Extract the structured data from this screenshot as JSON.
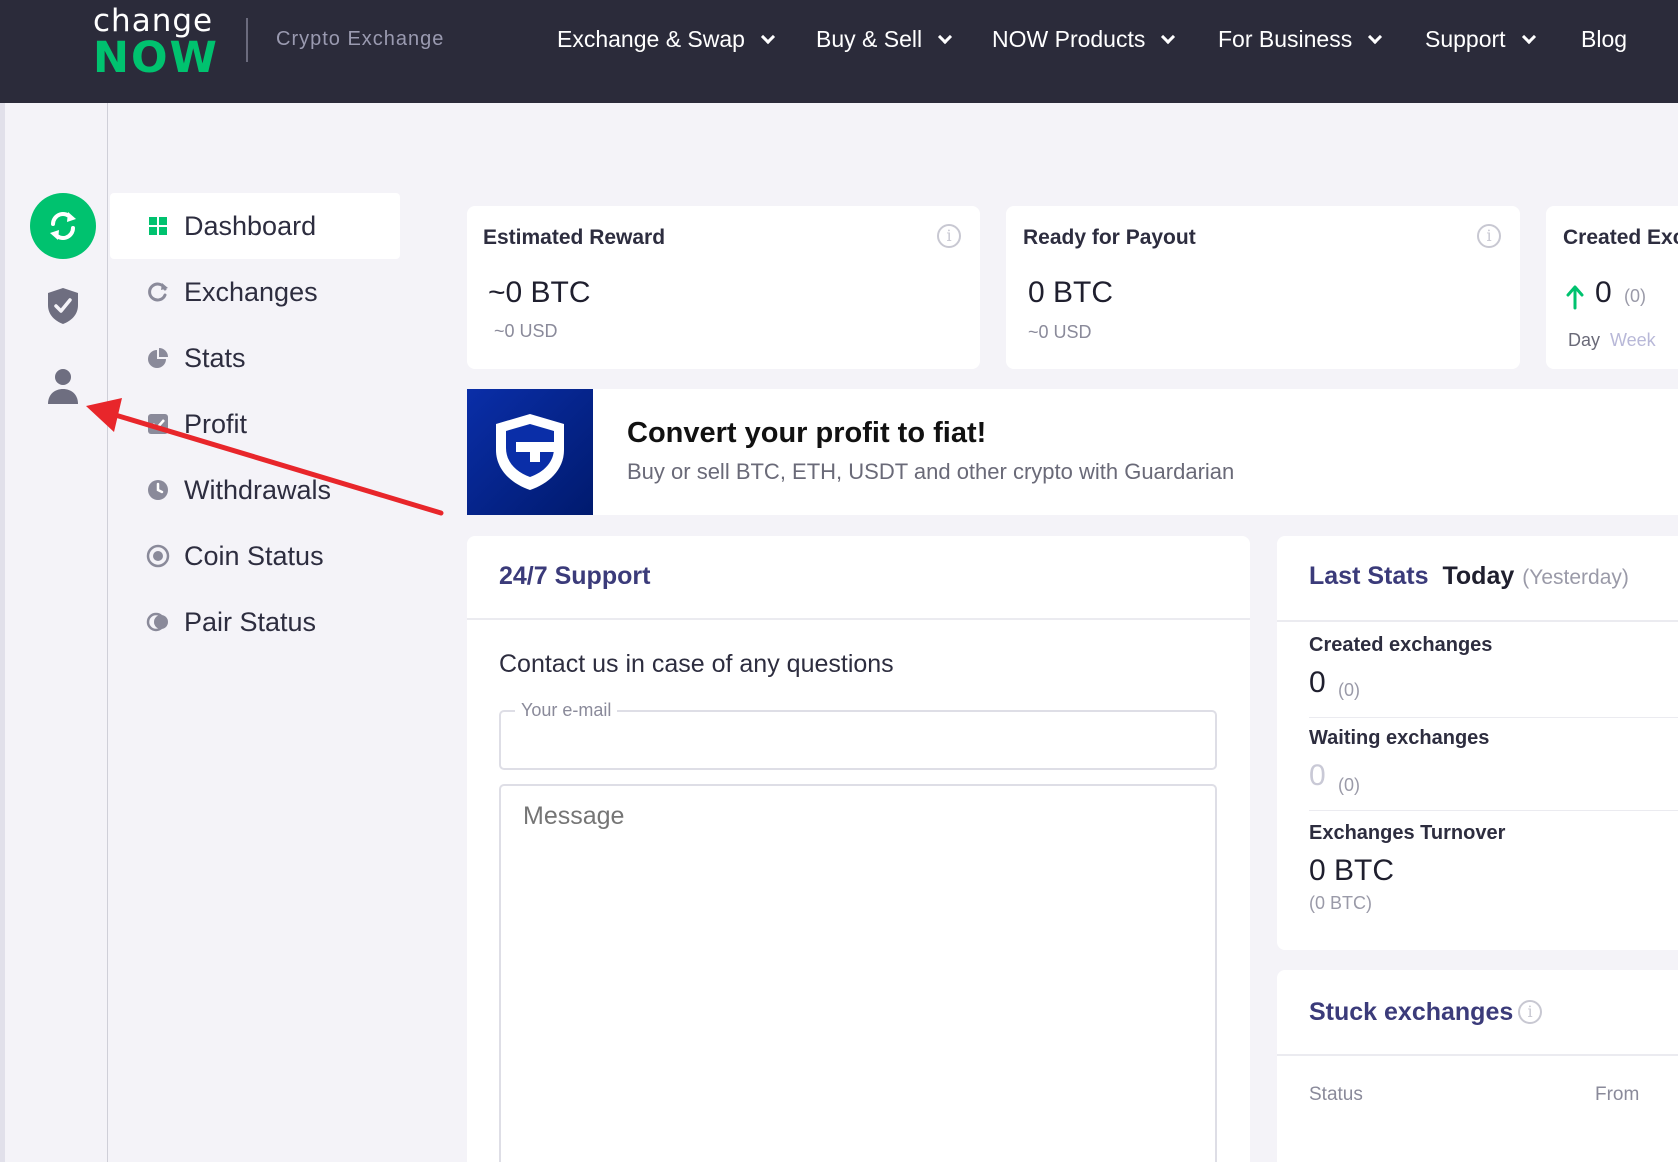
{
  "header": {
    "logo_top": "change",
    "logo_bottom": "NOW",
    "logo_sub": "Crypto Exchange",
    "nav": [
      {
        "label": "Exchange & Swap",
        "has_dropdown": true
      },
      {
        "label": "Buy & Sell",
        "has_dropdown": true
      },
      {
        "label": "NOW Products",
        "has_dropdown": true
      },
      {
        "label": "For Business",
        "has_dropdown": true
      },
      {
        "label": "Support",
        "has_dropdown": true
      },
      {
        "label": "Blog",
        "has_dropdown": false
      }
    ]
  },
  "rail": {
    "items": [
      {
        "icon": "exchange-cycle-icon",
        "active": true
      },
      {
        "icon": "shield-check-icon",
        "active": false
      },
      {
        "icon": "user-icon",
        "active": false
      }
    ]
  },
  "menu": {
    "items": [
      {
        "label": "Dashboard",
        "icon": "grid-icon",
        "active": true
      },
      {
        "label": "Exchanges",
        "icon": "refresh-icon",
        "active": false
      },
      {
        "label": "Stats",
        "icon": "pie-chart-icon",
        "active": false
      },
      {
        "label": "Profit",
        "icon": "check-square-icon",
        "active": false
      },
      {
        "label": "Withdrawals",
        "icon": "clock-icon",
        "active": false
      },
      {
        "label": "Coin Status",
        "icon": "coin-icon",
        "active": false
      },
      {
        "label": "Pair Status",
        "icon": "pair-icon",
        "active": false
      }
    ]
  },
  "cards": {
    "estimated": {
      "title": "Estimated Reward",
      "value": "~0 BTC",
      "sub": "~0 USD"
    },
    "payout": {
      "title": "Ready for Payout",
      "value": "0 BTC",
      "sub": "~0 USD"
    },
    "created": {
      "title": "Created Exc",
      "value": "0",
      "prev": "(0)",
      "period_day": "Day",
      "period_week": "Week"
    }
  },
  "banner": {
    "title": "Convert your profit to fiat!",
    "subtitle": "Buy or sell BTC, ETH, USDT and other crypto with Guardarian"
  },
  "support": {
    "title": "24/7 Support",
    "text": "Contact us in case of any questions",
    "email_label": "Your e-mail",
    "email_value": "",
    "message_placeholder": "Message"
  },
  "last_stats": {
    "title": "Last Stats",
    "today": "Today",
    "yesterday": "(Yesterday)",
    "created_label": "Created exchanges",
    "created_value": "0",
    "created_prev": "(0)",
    "waiting_label": "Waiting exchanges",
    "waiting_value": "0",
    "waiting_prev": "(0)",
    "turnover_label": "Exchanges Turnover",
    "turnover_value": "0 BTC",
    "turnover_prev": "(0 BTC)"
  },
  "stuck": {
    "title": "Stuck exchanges",
    "col_status": "Status",
    "col_from": "From"
  },
  "colors": {
    "brand_green": "#00c26f",
    "header_bg": "#2b2b3a",
    "link_navy": "#3b3b7a",
    "arrow_red": "#e8262b"
  }
}
